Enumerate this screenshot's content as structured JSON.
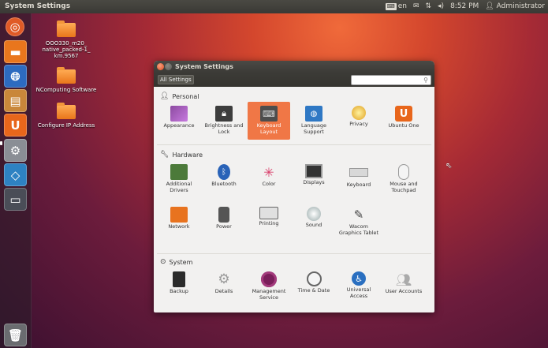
{
  "top_panel": {
    "title": "System Settings",
    "keyboard_layout": "en",
    "clock": "8:52 PM",
    "user": "Administrator"
  },
  "desktop": {
    "icons": [
      {
        "label": "OOO330_m20_ native_packed-1_ km.9567"
      },
      {
        "label": "NComputing Software"
      },
      {
        "label": "Configure IP Address"
      }
    ]
  },
  "window": {
    "title": "System Settings",
    "all_settings": "All Settings",
    "search_placeholder": "",
    "sections": [
      {
        "title": "Personal",
        "items": [
          {
            "label": "Appearance",
            "icon": "appearance-icon"
          },
          {
            "label": "Brightness and Lock",
            "icon": "brightness-icon"
          },
          {
            "label": "Keyboard Layout",
            "icon": "keyboard-layout-icon",
            "selected": true
          },
          {
            "label": "Language Support",
            "icon": "language-icon"
          },
          {
            "label": "Privacy",
            "icon": "privacy-icon"
          },
          {
            "label": "Ubuntu One",
            "icon": "ubuntu-one-icon"
          }
        ]
      },
      {
        "title": "Hardware",
        "items": [
          {
            "label": "Additional Drivers",
            "icon": "drivers-icon"
          },
          {
            "label": "Bluetooth",
            "icon": "bluetooth-icon"
          },
          {
            "label": "Color",
            "icon": "color-icon"
          },
          {
            "label": "Displays",
            "icon": "displays-icon"
          },
          {
            "label": "Keyboard",
            "icon": "keyboard-icon"
          },
          {
            "label": "Mouse and Touchpad",
            "icon": "mouse-icon"
          },
          {
            "label": "Network",
            "icon": "network-icon"
          },
          {
            "label": "Power",
            "icon": "power-icon"
          },
          {
            "label": "Printing",
            "icon": "printer-icon"
          },
          {
            "label": "Sound",
            "icon": "sound-icon"
          },
          {
            "label": "Wacom Graphics Tablet",
            "icon": "wacom-icon"
          }
        ]
      },
      {
        "title": "System",
        "items": [
          {
            "label": "Backup",
            "icon": "backup-icon"
          },
          {
            "label": "Details",
            "icon": "details-icon"
          },
          {
            "label": "Management Service",
            "icon": "management-icon"
          },
          {
            "label": "Time & Date",
            "icon": "clock-icon"
          },
          {
            "label": "Universal Access",
            "icon": "accessibility-icon"
          },
          {
            "label": "User Accounts",
            "icon": "users-icon"
          }
        ]
      }
    ]
  },
  "colors": {
    "selected_accent": "#f07746",
    "panel_bg": "#3c3b37"
  }
}
